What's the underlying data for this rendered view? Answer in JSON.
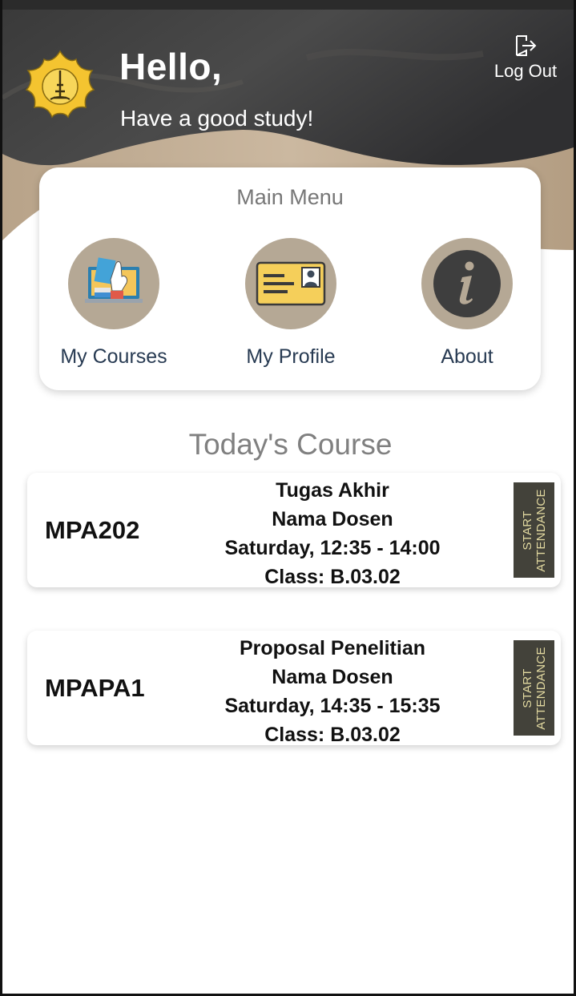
{
  "header": {
    "greeting": "Hello,",
    "subtitle": "Have a good study!",
    "logout_label": "Log Out",
    "logo_icon": "university-seal-icon",
    "logout_icon": "log-out-icon"
  },
  "main_menu": {
    "title": "Main Menu",
    "items": [
      {
        "label": "My Courses",
        "icon": "courses-icon"
      },
      {
        "label": "My Profile",
        "icon": "id-card-icon"
      },
      {
        "label": "About",
        "icon": "info-icon"
      }
    ]
  },
  "today": {
    "title": "Today's Course",
    "courses": [
      {
        "code": "MPA202",
        "name": "Tugas Akhir",
        "lecturer": "Nama Dosen",
        "schedule": "Saturday, 12:35 - 14:00",
        "class": "Class: B.03.02",
        "action_line1": "START",
        "action_line2": "ATTENDANCE"
      },
      {
        "code": "MPAPA1",
        "name": "Proposal Penelitian",
        "lecturer": "Nama Dosen",
        "schedule": "Saturday, 14:35 - 15:35",
        "class": "Class: B.03.02",
        "action_line1": "START",
        "action_line2": "ATTENDANCE"
      }
    ]
  },
  "colors": {
    "menu_circle": "#b5a895",
    "attendance_button": "#43423a",
    "attendance_text": "#e2d9a0",
    "menu_label": "#273a52"
  }
}
